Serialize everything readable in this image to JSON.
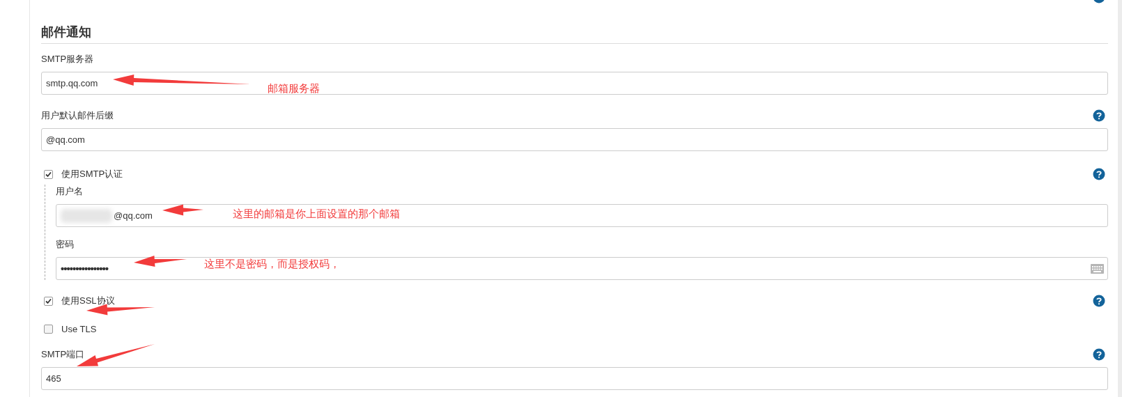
{
  "section": {
    "title": "邮件通知"
  },
  "fields": [
    {
      "kind": "text",
      "label": "SMTP服务器",
      "value": "smtp.qq.com",
      "help": false
    },
    {
      "kind": "text",
      "label": "用户默认邮件后缀",
      "value": "@qq.com",
      "help": true
    },
    {
      "kind": "checkbox",
      "label": "使用SMTP认证",
      "checked": true,
      "help": true,
      "children": [
        {
          "kind": "text",
          "label": "用户名",
          "value": "@qq.com",
          "redacted": true
        },
        {
          "kind": "password",
          "label": "密码",
          "value": "••••••••••••••••"
        }
      ]
    },
    {
      "kind": "checkbox",
      "label": "使用SSL协议",
      "checked": true,
      "help": true
    },
    {
      "kind": "checkbox",
      "label": "Use TLS",
      "checked": false,
      "help": false
    },
    {
      "kind": "text",
      "label": "SMTP端口",
      "value": "465",
      "help": true
    }
  ],
  "annotations": [
    "邮箱服务器",
    "这里的邮箱是你上面设置的那个邮箱",
    "这里不是密码，而是授权码，"
  ]
}
